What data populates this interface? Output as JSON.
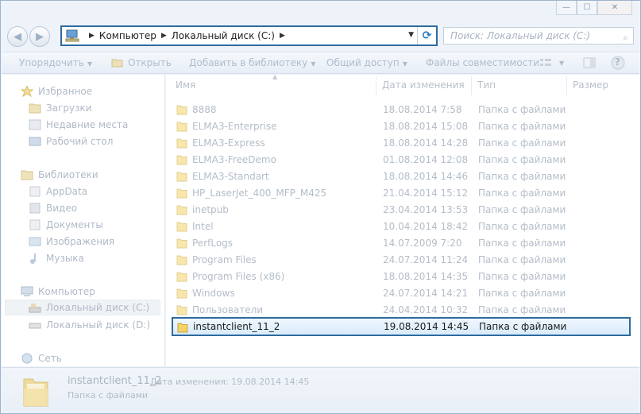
{
  "window": {
    "minimize_glyph": "—",
    "maximize_glyph": "☐",
    "close_glyph": "✕"
  },
  "nav": {
    "back_glyph": "◀",
    "forward_glyph": "▶",
    "address_crumbs": [
      "Компьютер",
      "Локальный диск (C:)"
    ],
    "crumb_sep": "▶",
    "dropdown_glyph": "▼",
    "refresh_glyph": "⟳",
    "search_placeholder": "Поиск: Локальный диск (C:)",
    "search_glyph": "⌕"
  },
  "toolbar": {
    "organize": "Упорядочить",
    "open": "Открыть",
    "add_to_library": "Добавить в библиотеку",
    "share": "Общий доступ",
    "compat_files": "Файлы совместимости",
    "dropdown_glyph": "▼",
    "help_glyph": "?"
  },
  "sidebar": {
    "favorites": {
      "label": "Избранное",
      "items": [
        "Загрузки",
        "Недавние места",
        "Рабочий стол"
      ]
    },
    "libraries": {
      "label": "Библиотеки",
      "items": [
        "AppData",
        "Видео",
        "Документы",
        "Изображения",
        "Музыка"
      ]
    },
    "computer": {
      "label": "Компьютер",
      "items": [
        "Локальный диск (C:)",
        "Локальный диск (D:)"
      ]
    },
    "network": {
      "label": "Сеть"
    }
  },
  "columns": {
    "name": "Имя",
    "date": "Дата изменения",
    "type": "Тип",
    "size": "Размер",
    "sort_glyph": "▲"
  },
  "files": [
    {
      "name": "8888",
      "date": "18.08.2014 7:58",
      "type": "Папка с файлами"
    },
    {
      "name": "ELMA3-Enterprise",
      "date": "18.08.2014 15:08",
      "type": "Папка с файлами"
    },
    {
      "name": "ELMA3-Express",
      "date": "18.08.2014 14:28",
      "type": "Папка с файлами"
    },
    {
      "name": "ELMA3-FreeDemo",
      "date": "01.08.2014 12:08",
      "type": "Папка с файлами"
    },
    {
      "name": "ELMA3-Standart",
      "date": "18.08.2014 14:46",
      "type": "Папка с файлами"
    },
    {
      "name": "HP_LaserJet_400_MFP_M425",
      "date": "21.04.2014 15:12",
      "type": "Папка с файлами"
    },
    {
      "name": "inetpub",
      "date": "23.04.2014 13:53",
      "type": "Папка с файлами"
    },
    {
      "name": "Intel",
      "date": "10.04.2014 18:42",
      "type": "Папка с файлами"
    },
    {
      "name": "PerfLogs",
      "date": "14.07.2009 7:20",
      "type": "Папка с файлами"
    },
    {
      "name": "Program Files",
      "date": "24.07.2014 11:24",
      "type": "Папка с файлами"
    },
    {
      "name": "Program Files (x86)",
      "date": "18.08.2014 14:35",
      "type": "Папка с файлами"
    },
    {
      "name": "Windows",
      "date": "24.07.2014 14:21",
      "type": "Папка с файлами"
    },
    {
      "name": "Пользователи",
      "date": "24.04.2014 10:32",
      "type": "Папка с файлами"
    },
    {
      "name": "instantclient_11_2",
      "date": "19.08.2014 14:45",
      "type": "Папка с файлами",
      "selected": true
    }
  ],
  "details": {
    "name": "instantclient_11_2",
    "date_label": "Дата изменения: 19.08.2014 14:45",
    "type": "Папка с файлами"
  },
  "colors": {
    "highlight_border": "#2d6b9f",
    "folder_yellow": "#f3d266"
  }
}
